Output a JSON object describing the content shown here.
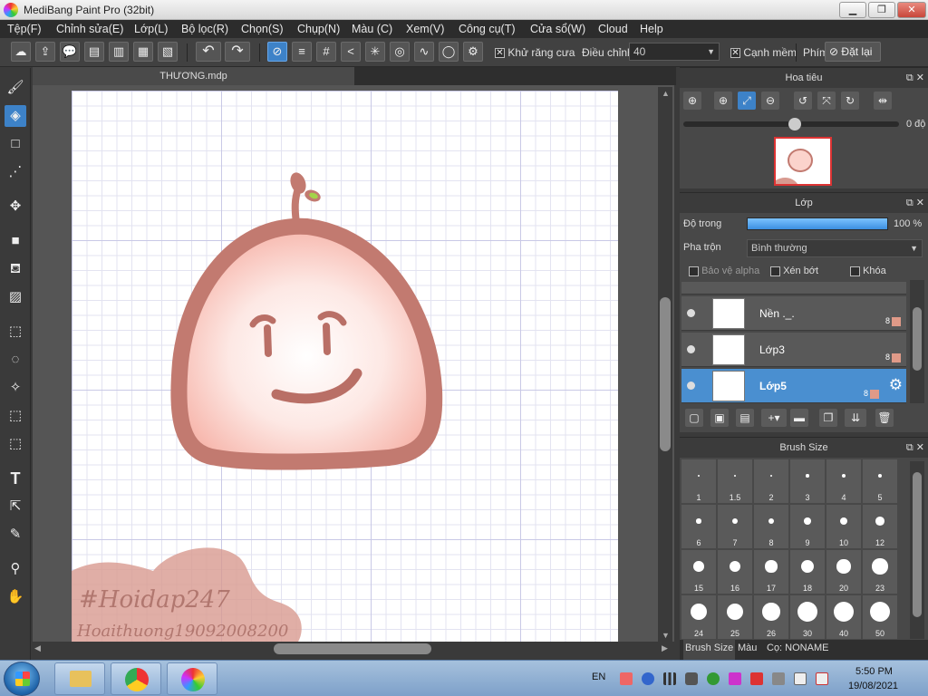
{
  "window": {
    "title": "MediBang Paint Pro (32bit)",
    "min_label": "▁",
    "restore_label": "❐",
    "close_label": "✕"
  },
  "menu": [
    "Tệp(F)",
    "Chỉnh sửa(E)",
    "Lớp(L)",
    "Bộ lọc(R)",
    "Chọn(S)",
    "Chụp(N)",
    "Màu (C)",
    "Xem(V)",
    "Công cụ(T)",
    "Cửa sổ(W)",
    "Cloud",
    "Help"
  ],
  "toolbar": {
    "antialias_label": "Khử răng cưa",
    "antialias_checked": "✕",
    "adjust_label": "Điều chỉnh",
    "adjust_value": "40",
    "smooth_label": "Cạnh mềm",
    "smooth_checked": "✕",
    "keys_label": "Phím",
    "reset_label": "Đặt lại"
  },
  "document": {
    "tab_title": "THƯƠNG.mdp"
  },
  "artwork": {
    "watermark_line1": "#Hoidap247",
    "watermark_line2": "Hoaithuong19092008200",
    "body_color": "#c27a70",
    "leaf_color": "#a3d34a",
    "fill_color": "#f7c8c0"
  },
  "navigator": {
    "title": "Hoa tiêu",
    "rotation": "0 độ"
  },
  "layers": {
    "title": "Lớp",
    "opacity_label": "Độ trong",
    "opacity_value": "100 %",
    "opacity": 1.0,
    "blend_label": "Pha trộn",
    "blend_value": "Bình thường",
    "protect_alpha": "Bảo vệ alpha",
    "clip": "Xén bớt",
    "lock": "Khóa",
    "items": [
      {
        "name": "Nền ._.",
        "bits": "8"
      },
      {
        "name": "Lớp3",
        "bits": "8"
      },
      {
        "name": "Lớp5",
        "bits": "8"
      }
    ]
  },
  "brush_size": {
    "title": "Brush Size",
    "sizes": [
      "1",
      "1.5",
      "2",
      "3",
      "4",
      "5",
      "6",
      "7",
      "8",
      "9",
      "10",
      "12",
      "15",
      "16",
      "17",
      "18",
      "20",
      "23",
      "24",
      "25",
      "26",
      "30",
      "40",
      "50"
    ]
  },
  "bottom_tabs": [
    "Brush Size",
    "Màu",
    "Cọ: NONAME"
  ],
  "taskbar": {
    "lang": "EN",
    "time": "5:50 PM",
    "date": "19/08/2021"
  }
}
